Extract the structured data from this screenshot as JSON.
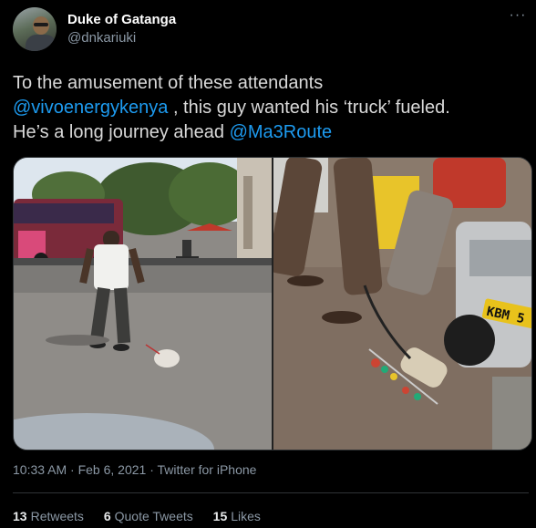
{
  "author": {
    "name": "Duke of Gatanga",
    "handle": "@dnkariuki"
  },
  "menu": {
    "more_icon": "more-horizontal-icon",
    "more_label": "···"
  },
  "tweet": {
    "line1": "To the amusement of these attendants",
    "mention1": "@vivoenergykenya",
    "line2_rest": " , this guy wanted his ‘truck’ fueled.",
    "line3_text": "He’s a long journey ahead ",
    "mention2": "@Ma3Route"
  },
  "media": {
    "photos": [
      {
        "plate_text": ""
      },
      {
        "plate_text": "KBM 5"
      }
    ]
  },
  "meta": {
    "timestamp": "10:33 AM · Feb 6, 2021 · Twitter for iPhone"
  },
  "stats": {
    "retweets_count": "13",
    "retweets_label": "Retweets",
    "quote_count": "6",
    "quote_label": "Quote Tweets",
    "likes_count": "15",
    "likes_label": "Likes"
  },
  "colors": {
    "background": "#000000",
    "text": "#d9d9d9",
    "secondary": "#8b98a5",
    "link": "#1d9bf0"
  }
}
